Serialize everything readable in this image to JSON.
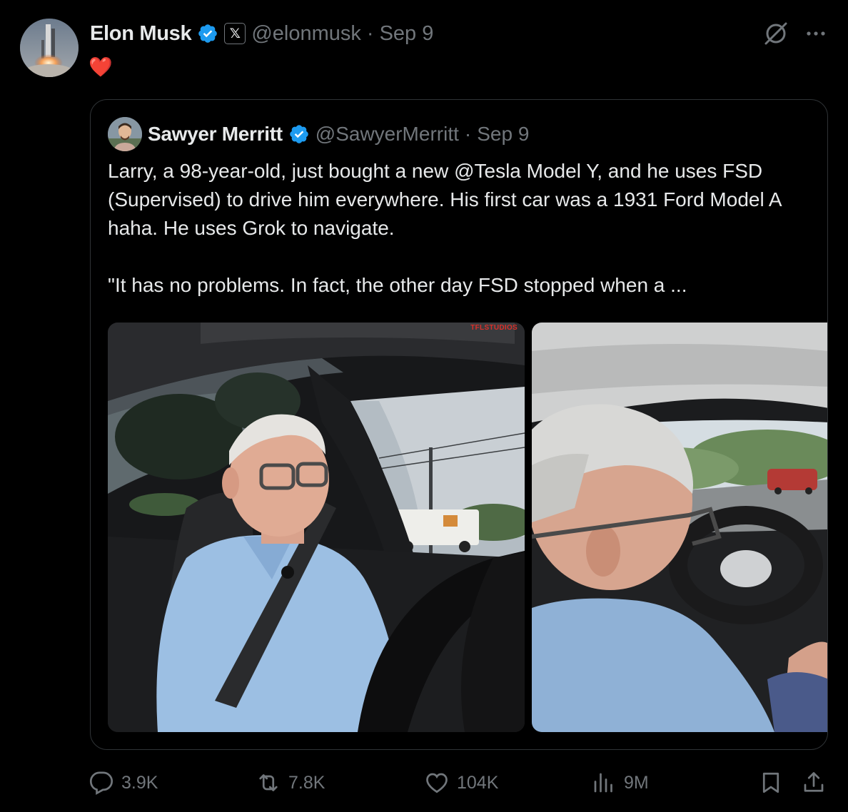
{
  "author": {
    "display_name": "Elon Musk",
    "handle": "@elonmusk",
    "separator": "·",
    "time": "Sep 9",
    "affiliate_badge": "𝕏"
  },
  "tweet_text": "❤️",
  "quoted": {
    "display_name": "Sawyer Merritt",
    "handle": "@SawyerMerritt",
    "separator": "·",
    "time": "Sep 9",
    "text": "Larry, a 98-year-old, just bought a new @Tesla Model Y, and he uses FSD (Supervised) to drive him everywhere. His first car was a 1931 Ford Model A haha. He uses Grok to navigate.\n\n\"It has no problems. In fact, the other day FSD stopped when a ...",
    "media_watermark": "TFLSTUDIOS"
  },
  "actions": {
    "replies": "3.9K",
    "reposts": "7.8K",
    "likes": "104K",
    "views": "9M"
  },
  "colors": {
    "background": "#000000",
    "text_primary": "#e7e9ea",
    "text_secondary": "#71767b",
    "verified_blue": "#1d9bf0",
    "border": "#2f3336"
  },
  "icons": [
    "grok-icon",
    "more-icon",
    "verified-icon",
    "reply-icon",
    "repost-icon",
    "like-icon",
    "views-icon",
    "bookmark-icon",
    "share-icon"
  ]
}
